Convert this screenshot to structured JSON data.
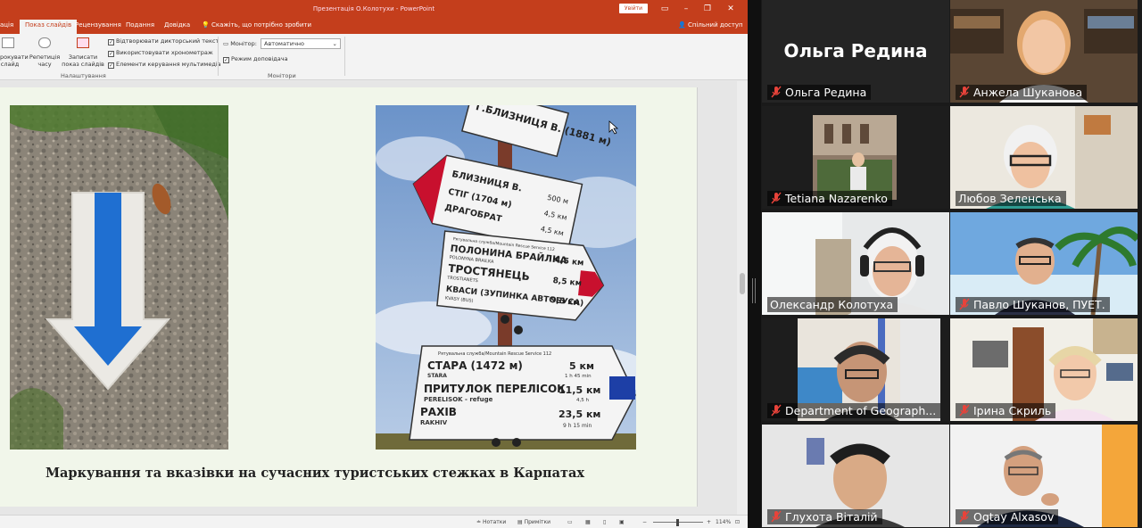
{
  "ppt": {
    "title": "Презентація О.Колотухи  -  PowerPoint",
    "signin_label": "Увійти",
    "tabs": [
      "ація",
      "Показ слайдів",
      "Рецензування",
      "Подання",
      "Довідка"
    ],
    "tell_me": "Скажіть, що потрібно зробити",
    "share": "Спільний доступ",
    "ribbon": {
      "record_btn": "рокувати слайд",
      "rehearse_btn": "Репетиція часу",
      "record_show_btn": "Записати показ слайдів",
      "checks": [
        "Відтворювати дикторський текст",
        "Використовувати хронометраж",
        "Елементи керування мультимедіа"
      ],
      "group_setup": "Налаштування",
      "monitor_label": "Монітор:",
      "monitor_value": "Автоматично",
      "presenter_view": "Режим доповідача",
      "group_monitors": "Монітори"
    },
    "slide_caption": "Маркування та вказівки на сучасних туристських стежках в Карпатах",
    "sign": {
      "top1": "Г.БЛИЗНИЦЯ В. (1881 м)",
      "arrow1_title": "БЛИЗНИЦЯ В.",
      "arrow1_lines": [
        "СТІГ (1704 м)",
        "ДРАГОБРАТ"
      ],
      "arrow1_dist": [
        "500 м",
        "4,5 км",
        "4,5 км"
      ],
      "arrow2_header": "Рятувальна служба/Mountain Rescue Service 112",
      "arrow2_lines": [
        "ПОЛОНИНА БРАЙЛКА",
        "ТРОСТЯНЕЦЬ",
        "КВАСИ (ЗУПИНКА АВТОБУСА)"
      ],
      "arrow2_sub": [
        "POLONYNA BRAILKA",
        "TROSTIANETS",
        "KVASY (BUS)"
      ],
      "arrow2_dist": [
        "4,5 км",
        "8,5 км",
        "9,5 км"
      ],
      "arrow3_header": "Рятувальна служба/Mountain Rescue Service 112",
      "arrow3_lines": [
        "СТАРА (1472 м)",
        "ПРИТУЛОК ПЕРЕЛІСОК",
        "РАХІВ"
      ],
      "arrow3_sub": [
        "STARA",
        "PERELISOK - refuge",
        "RAKHIV"
      ],
      "arrow3_dist": [
        "5 км",
        "11,5 км",
        "23,5 км"
      ],
      "arrow3_time": [
        "1 h 45 min",
        "4,5 h",
        "9 h 15 min"
      ]
    },
    "status": {
      "notes": "Нотатки",
      "comments": "Примітки",
      "zoom": "114%"
    }
  },
  "participants": [
    {
      "name": "Ольга Редина",
      "big_name": "Ольга Редина",
      "muted": true
    },
    {
      "name": "Анжела Шуканова",
      "muted": true
    },
    {
      "name": "Tetiana Nazarenko",
      "muted": true
    },
    {
      "name": "Любов Зеленська",
      "muted": false
    },
    {
      "name": "Олександр Колотуха",
      "muted": false,
      "active_speaker": true
    },
    {
      "name": "Павло Шуканов, ПУЕТ.",
      "muted": true
    },
    {
      "name": "Department of Geograph...",
      "muted": true
    },
    {
      "name": "Ірина Скриль",
      "muted": true
    },
    {
      "name": "Глухота Віталій",
      "muted": true
    },
    {
      "name": "Oqtay Alxasov",
      "muted": true
    }
  ],
  "colors": {
    "ppt_accent": "#c43e1c",
    "active_speaker_border": "#25c26a",
    "mute_icon": "#e8433a",
    "trail_blue": "#1f6fd1",
    "sign_red": "#c8102e"
  }
}
